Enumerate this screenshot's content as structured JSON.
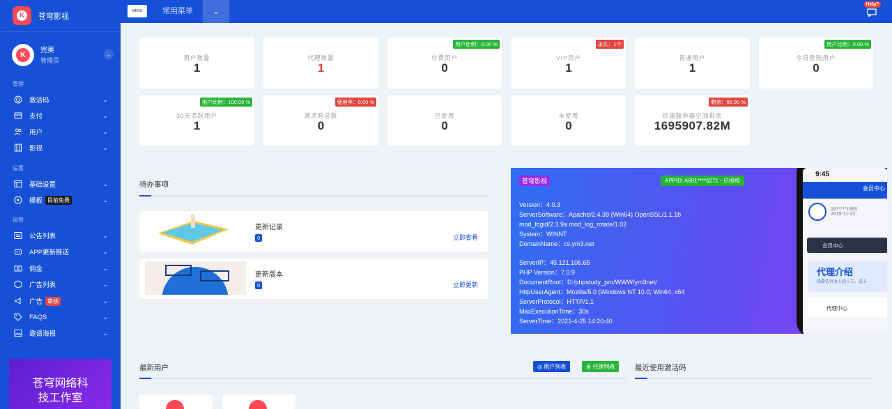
{
  "sidebar": {
    "brand": "苍穹影视",
    "user": {
      "name": "完美",
      "role": "管理员"
    },
    "sections": {
      "manage": "管理",
      "settings": "设置",
      "operations": "运营"
    },
    "items": [
      {
        "label": "激活码",
        "icon": "fingerprint-icon"
      },
      {
        "label": "支付",
        "icon": "wallet-icon"
      },
      {
        "label": "用户",
        "icon": "users-icon"
      },
      {
        "label": "影视",
        "icon": "film-icon"
      },
      {
        "label": "基础设置",
        "icon": "window-icon"
      },
      {
        "label": "模板",
        "icon": "palette-icon",
        "badge": "目前免费"
      },
      {
        "label": "公告列表",
        "icon": "notice-icon"
      },
      {
        "label": "APP更新推送",
        "icon": "robot-icon"
      },
      {
        "label": "佣金",
        "icon": "money-icon"
      },
      {
        "label": "广告列表",
        "icon": "box-icon"
      },
      {
        "label": "广告",
        "icon": "megaphone-icon",
        "badge": "审核"
      },
      {
        "label": "FAQS",
        "icon": "tag-icon"
      },
      {
        "label": "邀请海报",
        "icon": "image-icon"
      }
    ],
    "promo": [
      "苍穹网络科",
      "技工作室"
    ]
  },
  "topbar": {
    "menu_icon_text": "MENU",
    "menu_label": "常用菜单",
    "help_label": "Help?"
  },
  "stats": [
    {
      "label": "用户数量",
      "value": "1"
    },
    {
      "label": "代理数量",
      "value": "1"
    },
    {
      "label": "付费用户",
      "value": "0",
      "tag": "用户比例：0.00 %"
    },
    {
      "label": "VIP用户",
      "value": "1",
      "tag": "永久：1个"
    },
    {
      "label": "普通用户",
      "value": "1"
    },
    {
      "label": "今日登陆用户",
      "value": "0",
      "tag": "用户比例：0.00 %"
    },
    {
      "label": "30天活跃用户",
      "value": "1",
      "tag": "用户比例：100.00 %"
    },
    {
      "label": "激活码总数",
      "value": "0",
      "tag": "使用率：0.00 %"
    },
    {
      "label": "已使用",
      "value": "0"
    },
    {
      "label": "未使用",
      "value": "0"
    },
    {
      "label": "终端服务器空间剩余",
      "value": "1695907.82M",
      "tag": "剩余：88.90 %"
    }
  ],
  "todo": {
    "title": "待办事项",
    "items": [
      {
        "title": "更新记录",
        "count": "0",
        "link": "立即查看"
      },
      {
        "title": "更新版本",
        "count": "0",
        "link": "立即更新"
      }
    ]
  },
  "info": {
    "brand_tag": "苍穹影视",
    "appid": "APPID: A601****6271 - 已授权",
    "lines_a": [
      "Version：4.0.3",
      "ServerSoftware：Apache/2.4.39 (Win64) OpenSSL/1.1.1b",
      "mod_fcgid/2.3.9a mod_log_rotate/1.02",
      "System：WINNT",
      "DomainName：cs.ym3.net"
    ],
    "lines_b": [
      "ServerIP：45.121.106.65",
      "PHP Version：7.0.9",
      "DocumentRoot：D:/phpstudy_pro/WWW/ym3net/",
      "HttpUserAgent：Mozilla/5.0 (Windows NT 10.0; Win64; x64",
      "ServerProtocol：HTTP/1.1",
      "MaxExecutionTime：30s",
      "ServerTime：2021-4-25 14:20:40"
    ],
    "phone": {
      "time": "9:45",
      "header": "会员中心",
      "user_id": "187****1866",
      "date": "2019-11-22",
      "bar": "会员中心",
      "banner": "代理介绍",
      "banner_sub": "随要告诉收入超十万、或卡",
      "item": "代理中心"
    }
  },
  "bottom": {
    "newest_users": "最新用户",
    "btn_user_list": "用户列表",
    "btn_agent_list": "代理列表",
    "recent_codes": "最近使用激活码"
  }
}
